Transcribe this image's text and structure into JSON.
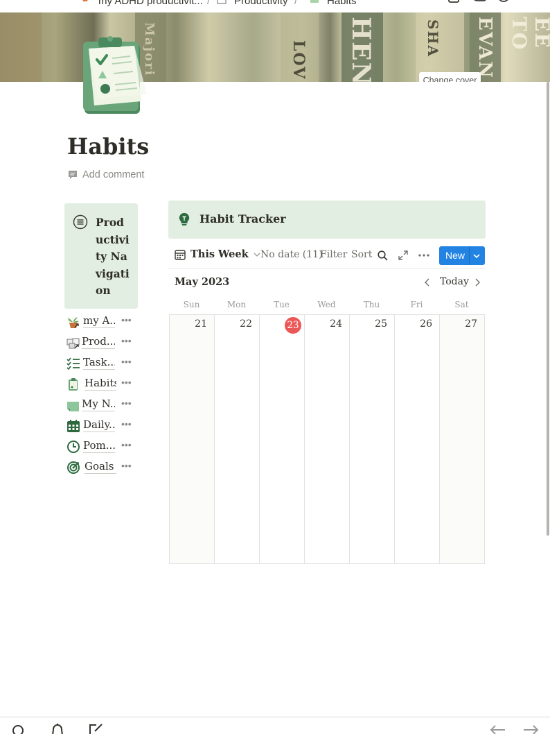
{
  "breadcrumb": {
    "items": [
      "my ADHD productivit...",
      "Productivity",
      "Habits"
    ],
    "separator": "/"
  },
  "cover": {
    "spine_texts": [
      "Majori",
      "LOV",
      "HEN",
      "SHA",
      "EVAN",
      "EE TO"
    ],
    "change_cover_label": "Change cover"
  },
  "page": {
    "title": "Habits",
    "add_comment_label": "Add comment"
  },
  "navigation": {
    "title": "Productivity Navigation",
    "items": [
      {
        "label": "my A...",
        "icon": "potted-plant-link-icon"
      },
      {
        "label": "Prod...",
        "icon": "boxes-link-icon"
      },
      {
        "label": "Task...",
        "icon": "checklist-icon"
      },
      {
        "label": "Habits",
        "icon": "clipboard-icon"
      },
      {
        "label": "My N...",
        "icon": "note-icon"
      },
      {
        "label": "Daily...",
        "icon": "calendar-icon"
      },
      {
        "label": "Pom...",
        "icon": "clock-icon"
      },
      {
        "label": "Goals",
        "icon": "target-icon"
      }
    ],
    "more_glyph": "•••"
  },
  "tracker": {
    "title": "Habit Tracker",
    "view_label": "This Week",
    "no_date_label": "No date (11)",
    "filter_label": "Filter",
    "sort_label": "Sort",
    "new_label": "New"
  },
  "calendar": {
    "month_label": "May 2023",
    "today_label": "Today",
    "weekdays": [
      "Sun",
      "Mon",
      "Tue",
      "Wed",
      "Thu",
      "Fri",
      "Sat"
    ],
    "days": [
      "21",
      "22",
      "23",
      "24",
      "25",
      "26",
      "27"
    ],
    "today_day": "23"
  },
  "colors": {
    "accent": "#2383e2",
    "callout_bg": "#e3eee3",
    "today_badge": "#eb5757",
    "icon_green": "#2d6b3f"
  }
}
